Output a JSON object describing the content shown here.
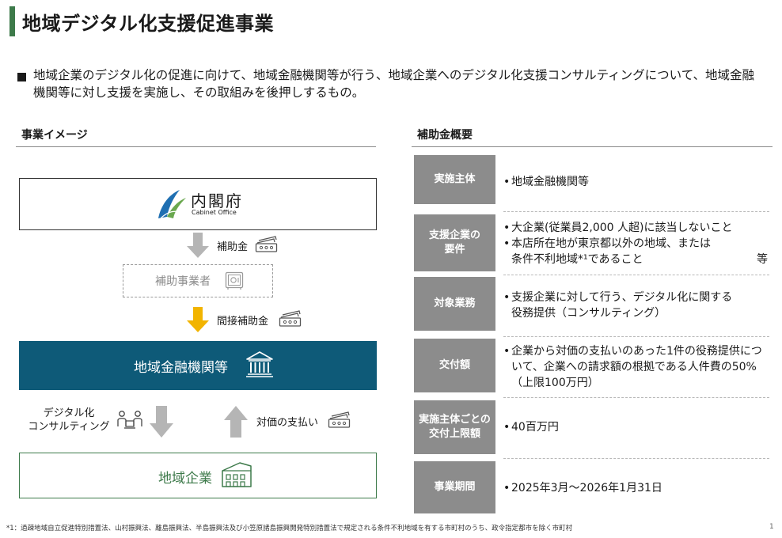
{
  "title": "地域デジタル化支援促進事業",
  "intro": "地域企業のデジタル化の促進に向けて、地域金融機関等が行う、地域企業へのデジタル化支援コンサルティングについて、地域金融機関等に対し支援を実施し、その取組みを後押しするもの。",
  "left_section": {
    "heading": "事業イメージ",
    "cabinet_name": "内閣府",
    "cabinet_en": "Cabinet Office",
    "arrow1_label": "補助金",
    "sub_box": "補助事業者",
    "arrow2_label": "間接補助金",
    "bank_box": "地域金融機関等",
    "consult_label": "デジタル化\nコンサルティング",
    "payment_label": "対価の支払い",
    "region_box": "地域企業"
  },
  "right_section": {
    "heading": "補助金概要",
    "rows": [
      {
        "head": "実施主体",
        "items": [
          "地域金融機関等"
        ]
      },
      {
        "head": "支援企業の\n要件",
        "items": [
          "大企業(従業員2,000 人超)に該当しないこと",
          "本店所在地が東京都以外の地域、または\n条件不利地域*¹であること"
        ],
        "suffix": "等"
      },
      {
        "head": "対象業務",
        "items": [
          "支援企業に対して行う、デジタル化に関する\n役務提供（コンサルティング）"
        ]
      },
      {
        "head": "交付額",
        "items": [
          "企業から対価の支払いのあった1件の役務提供について、企業への請求額の根拠である人件費の50%（上限100万円）"
        ]
      },
      {
        "head": "実施主体ごとの\n交付上限額",
        "items": [
          "40百万円"
        ]
      },
      {
        "head": "事業期間",
        "items": [
          "2025年3月～2026年1月31日"
        ]
      }
    ]
  },
  "footnote": "*1：過疎地域自立促進特別措置法、山村振興法、離島振興法、半島振興法及び小笠原諸島振興開発特別措置法で規定される条件不利地域を有する市町村のうち、政令指定都市を除く市町村",
  "page_number": "1",
  "colors": {
    "accent_green": "#3d7a4a",
    "bank_blue": "#0e5a78",
    "arrow_gold": "#f2b400",
    "arrow_gray": "#b5b5b5",
    "row_head_gray": "#8c8c8c"
  },
  "icons": [
    "cabinet-logo-icon",
    "banknote-icon",
    "safe-icon",
    "bank-building-icon",
    "consulting-people-icon",
    "shop-building-icon"
  ]
}
